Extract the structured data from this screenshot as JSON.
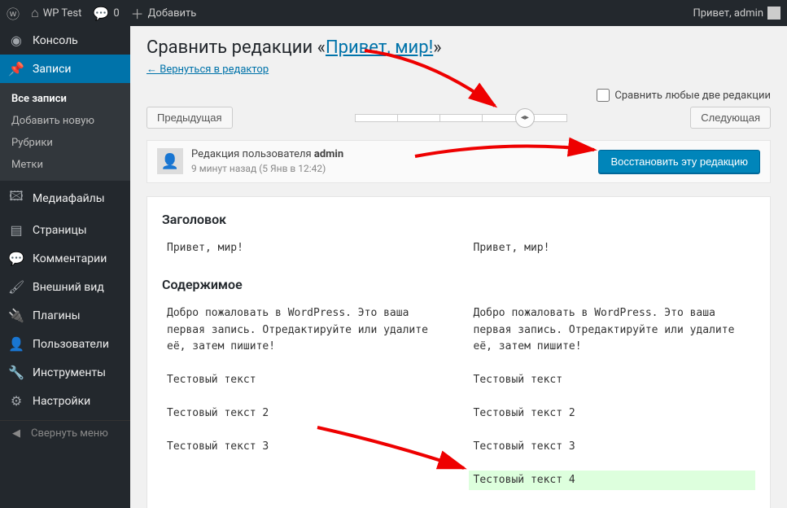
{
  "adminbar": {
    "site": "WP Test",
    "comments": "0",
    "add": "Добавить",
    "greeting": "Привет, admin"
  },
  "sidebar": {
    "items": [
      {
        "icon": "◉",
        "label": "Консоль"
      },
      {
        "icon": "📌",
        "label": "Записи"
      },
      {
        "icon": "🖾",
        "label": "Медиафайлы"
      },
      {
        "icon": "▤",
        "label": "Страницы"
      },
      {
        "icon": "💬",
        "label": "Комментарии"
      },
      {
        "icon": "🖌",
        "label": "Внешний вид"
      },
      {
        "icon": "🔌",
        "label": "Плагины"
      },
      {
        "icon": "👤",
        "label": "Пользователи"
      },
      {
        "icon": "🔧",
        "label": "Инструменты"
      },
      {
        "icon": "⚙",
        "label": "Настройки"
      }
    ],
    "submenu": [
      "Все записи",
      "Добавить новую",
      "Рубрики",
      "Метки"
    ],
    "collapse": "Свернуть меню"
  },
  "page": {
    "title_prefix": "Сравнить редакции «",
    "title_link": "Привет, мир!",
    "title_suffix": "»",
    "back": "← Вернуться в редактор",
    "compare_any": "Сравнить любые две редакции",
    "prev": "Предыдущая",
    "next": "Следующая",
    "meta_author_prefix": "Редакция пользователя ",
    "meta_author": "admin",
    "meta_time_rel": "9 минут назад",
    "meta_time_abs": "(5 Янв в 12:42)",
    "restore": "Восстановить эту редакцию",
    "diff": {
      "title_h": "Заголовок",
      "title_left": "Привет, мир!",
      "title_right": "Привет, мир!",
      "content_h": "Содержимое",
      "left": [
        "Добро пожаловать в WordPress. Это ваша первая запись. Отредактируйте или удалите её, затем пишите!",
        "",
        "Тестовый текст",
        "",
        "Тестовый текст 2",
        "",
        "Тестовый текст 3"
      ],
      "right": [
        "Добро пожаловать в WordPress. Это ваша первая запись. Отредактируйте или удалите её, затем пишите!",
        "",
        "Тестовый текст",
        "",
        "Тестовый текст 2",
        "",
        "Тестовый текст 3",
        "",
        "Тестовый текст 4"
      ],
      "added_index_right": 8
    }
  }
}
